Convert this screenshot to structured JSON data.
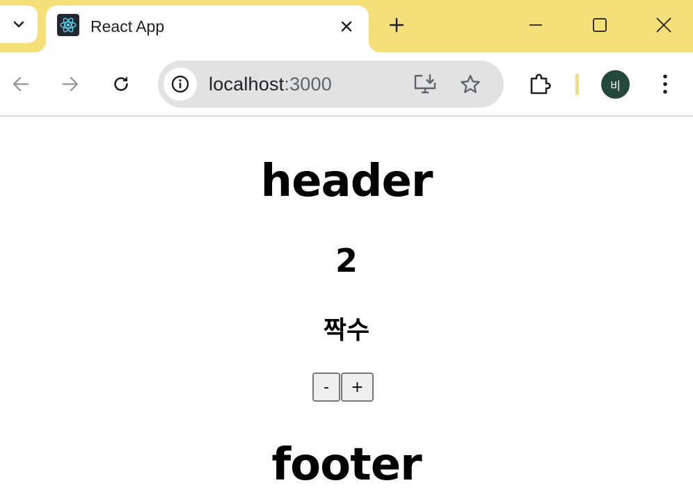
{
  "browser": {
    "tab": {
      "title": "React App",
      "favicon": "react-logo-icon"
    },
    "address_bar": {
      "host": "localhost",
      "port": ":3000"
    },
    "profile": {
      "initial": "비",
      "color": "#24483b"
    },
    "colors": {
      "frame": "#f5df78",
      "omnibox": "#e2e2e2"
    },
    "icons": {
      "tab_search": "chevron-down-icon",
      "tab_close": "close-icon",
      "new_tab": "plus-icon",
      "back": "arrow-left-icon",
      "forward": "arrow-right-icon",
      "reload": "reload-icon",
      "site_info": "info-icon",
      "install": "install-app-icon",
      "bookmark": "star-icon",
      "extensions": "puzzle-icon",
      "menu": "kebab-menu-icon"
    }
  },
  "page": {
    "header": "header",
    "count": "2",
    "parity": "짝수",
    "buttons": {
      "decrement": "-",
      "increment": "+"
    },
    "footer": "footer"
  }
}
